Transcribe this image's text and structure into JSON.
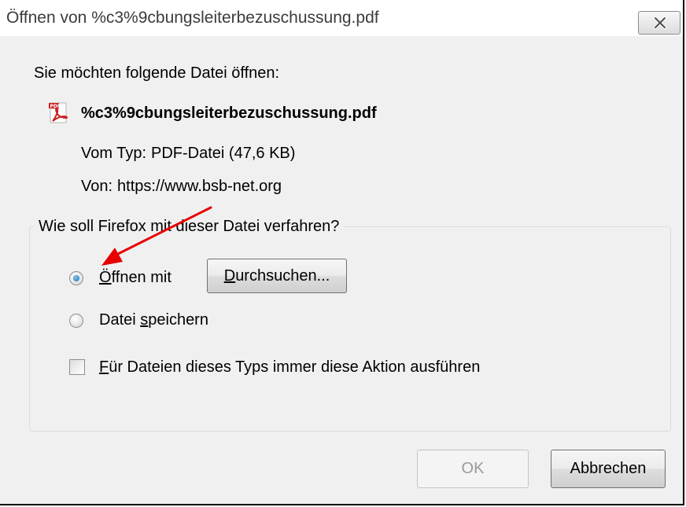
{
  "dialog": {
    "title": "Öffnen von %c3%9cbungsleiterbezuschussung.pdf",
    "intro": "Sie möchten folgende Datei öffnen:",
    "file": {
      "icon": "pdf-file-icon",
      "name": "%c3%9cbungsleiterbezuschussung.pdf",
      "type_label": "Vom Typ:",
      "type_value": "PDF-Datei (47,6 KB)",
      "source_label": "Von:",
      "source_value": "https://www.bsb-net.org"
    },
    "action_group": {
      "legend": "Wie soll Firefox mit dieser Datei verfahren?",
      "open_with": {
        "label_first": "Ö",
        "label_rest": "ffnen mit",
        "checked": true
      },
      "browse_button": {
        "label_first": "D",
        "label_rest": "urchsuchen..."
      },
      "save_file": {
        "label_before": "Datei ",
        "label_accel": "s",
        "label_after": "peichern",
        "checked": false
      },
      "always_action": {
        "label_first": "F",
        "label_rest": "ür Dateien dieses Typs immer diese Aktion ausführen",
        "checked": false
      }
    },
    "buttons": {
      "ok": "OK",
      "cancel": "Abbrechen"
    }
  },
  "colors": {
    "annotation_arrow": "#e60000",
    "dialog_background": "#f0f0f0",
    "radio_selected": "#1a6fb5"
  }
}
